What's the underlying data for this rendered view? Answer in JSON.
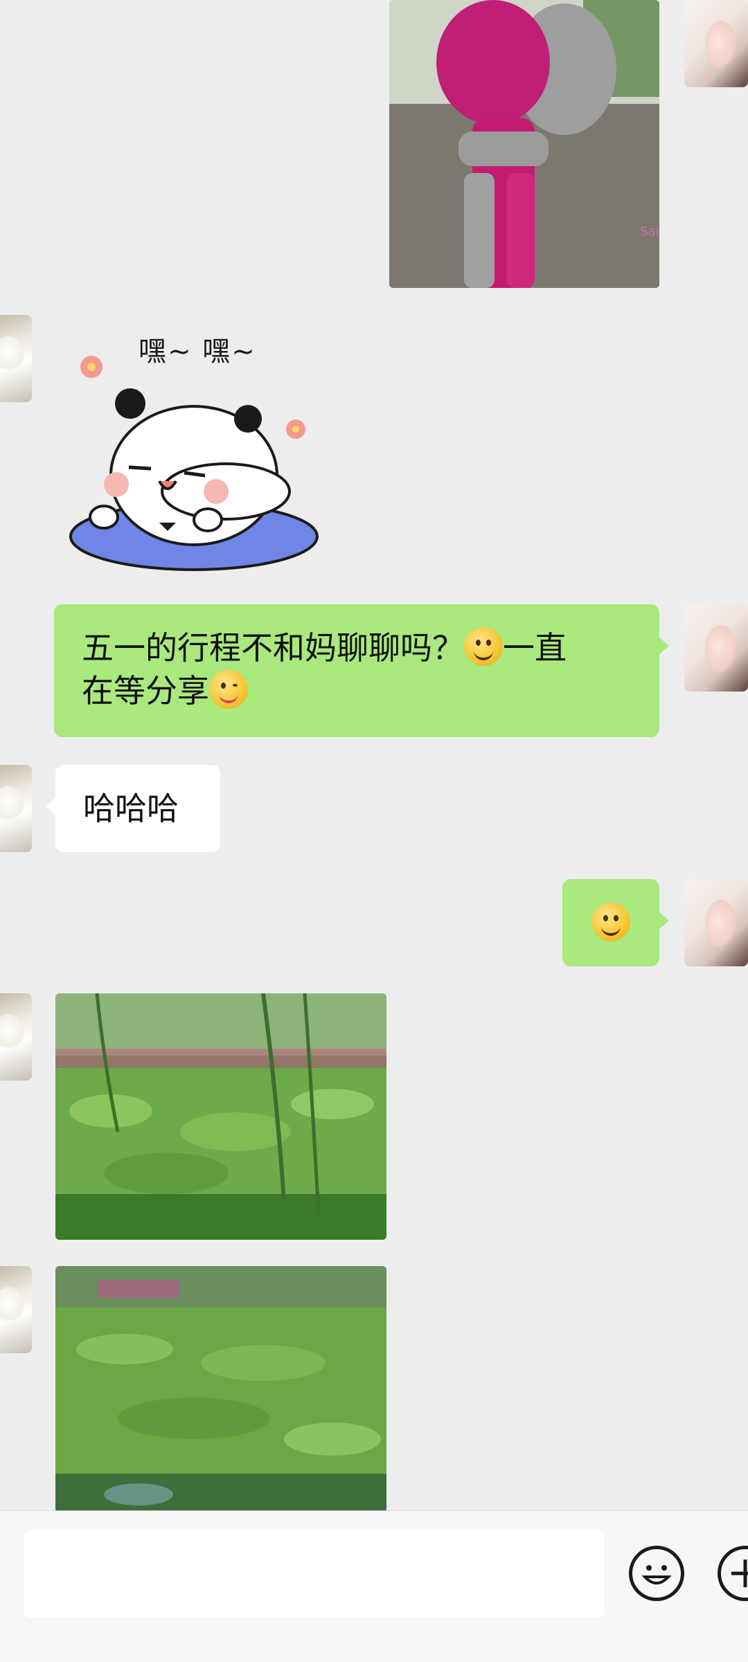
{
  "messages": {
    "sticker_text": "嘿~ 嘿~",
    "msg1_text": "五一的行程不和妈聊聊吗？",
    "msg1_text_after": "一直",
    "msg1_text_line2": "在等分享",
    "msg2_text": "哈哈哈",
    "photo_watermark": "Sai"
  },
  "icons": {
    "emoji_button": "smiley-face-icon",
    "plus_button": "plus-circle-icon"
  },
  "colors": {
    "self_bubble": "#a9e97e",
    "other_bubble": "#ffffff",
    "background": "#ededed"
  }
}
